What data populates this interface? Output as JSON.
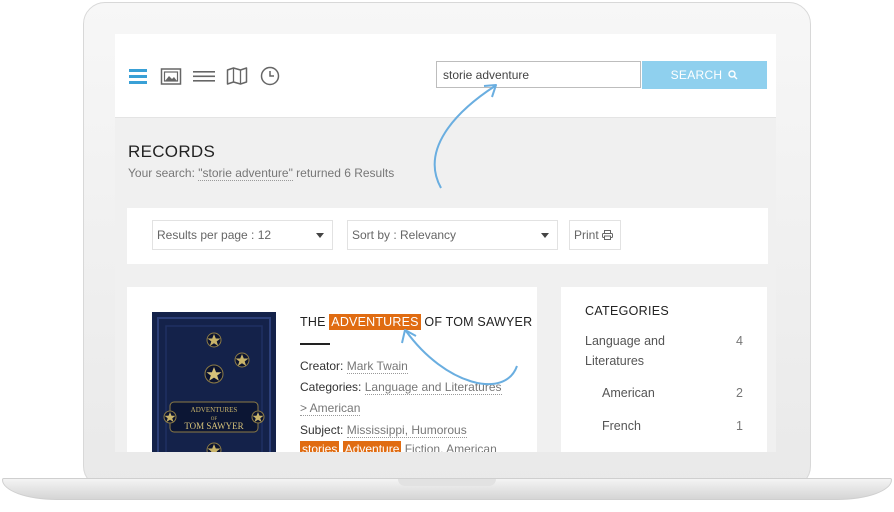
{
  "search": {
    "value": "storie adventure",
    "button_label": "SEARCH"
  },
  "records": {
    "title": "RECORDS",
    "search_prefix": "Your search: ",
    "query": "\"storie adventure\"",
    "search_suffix": " returned 6 Results"
  },
  "controls": {
    "per_page": "Results per page : 12",
    "sort": "Sort by : Relevancy",
    "print": "Print"
  },
  "result": {
    "title_pre": "THE ",
    "title_hl": "ADVENTURES",
    "title_post": " OF TOM SAWYER",
    "creator_label": "Creator:",
    "creator": "Mark Twain",
    "categories_label": "Categories:",
    "categories_line1": "Language and Literatures",
    "categories_line2": "> American",
    "subject_label": "Subject:",
    "subject": "Mississippi, Humorous",
    "subject_hl1": "stories",
    "subject_hl2": "Adventure",
    "subject_rest": " Fiction, American"
  },
  "categories": {
    "heading": "CATEGORIES",
    "items": [
      {
        "label_line1": "Language and",
        "label_line2": "Literatures",
        "count": "4"
      },
      {
        "label": "American",
        "count": "2"
      },
      {
        "label": "French",
        "count": "1"
      }
    ]
  },
  "colors": {
    "accent": "#8fd0ee",
    "highlight": "#e06c12",
    "icon_active": "#39a0d6",
    "icon_inactive": "#666666",
    "arrow": "#6aaee0"
  },
  "icons": [
    "list-view-icon",
    "gallery-view-icon",
    "compact-list-icon",
    "map-view-icon",
    "timeline-icon",
    "search-icon",
    "print-icon",
    "chevron-down-icon"
  ]
}
